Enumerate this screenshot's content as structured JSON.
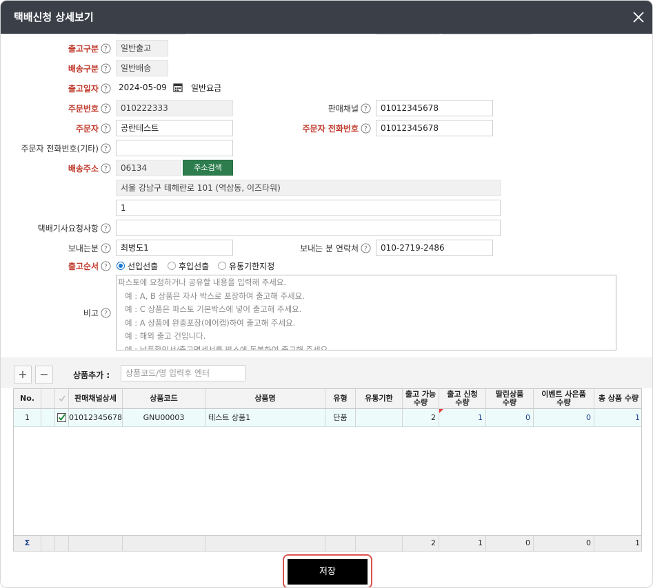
{
  "window": {
    "title": "택배신청 상세보기"
  },
  "form": {
    "out_type": {
      "label": "출고구분",
      "value": "일반출고"
    },
    "ship_type": {
      "label": "배송구분",
      "value": "일반배송"
    },
    "out_date": {
      "label": "출고일자",
      "value": "2024-05-09",
      "fee": "일반요금"
    },
    "order_no": {
      "label": "주문번호",
      "value": "010222333"
    },
    "sales_channel": {
      "label": "판매채널",
      "value": "01012345678"
    },
    "orderer": {
      "label": "주문자",
      "value": "공란테스트"
    },
    "orderer_phone": {
      "label": "주문자 전화번호",
      "value": "01012345678"
    },
    "orderer_phone_etc": {
      "label": "주문자 전화번호(기타)",
      "value": ""
    },
    "address": {
      "label": "배송주소",
      "zip": "06134",
      "search_button": "주소검색",
      "line1": "서울 강남구 테헤란로 101 (역삼동, 이즈타워)",
      "line2": "1"
    },
    "courier_request": {
      "label": "택배기사요청사항",
      "value": ""
    },
    "sender": {
      "label": "보내는분",
      "value": "최병도1"
    },
    "sender_phone": {
      "label": "보내는 분 연락처",
      "value": "010-2719-2486"
    },
    "out_order": {
      "label": "출고순서",
      "options": [
        "선입선출",
        "후입선출",
        "유통기한지정"
      ],
      "selected": "선입선출"
    },
    "memo": {
      "label": "비고",
      "placeholder_lines": [
        "파스토에 요청하거나 공유할 내용을 입력해 주세요.",
        "예 : A, B 상품은 자사 박스로 포장하여 출고해 주세요.",
        "예 : C 상품은 파스토 기본박스에 넣어 출고해 주세요.",
        "예 : A 상품에 완충포장(에어캡)하여 출고해 주세요.",
        "예 : 해외 출고 건입니다.",
        "예 : 납품확인서/출고명세서를 박스에 동봉하여 출고해 주세요."
      ]
    }
  },
  "product_bar": {
    "add_label": "상품추가 :",
    "add_placeholder": "상품코드/명 입력후 엔터",
    "plus": "+",
    "minus": "−"
  },
  "grid": {
    "headers": {
      "no": "No.",
      "channel": "판매채널상세",
      "code": "상품코드",
      "name": "상품명",
      "type": "유형",
      "expiry": "유통기한",
      "avail_1": "출고 가능",
      "avail_2": "수량",
      "req_1": "출고 신청",
      "req_2": "수량",
      "attached_1": "딸린상품",
      "attached_2": "수량",
      "gift_1": "이벤트 사은품",
      "gift_2": "수량",
      "total": "총 상품 수량"
    },
    "rows": [
      {
        "no": "1",
        "channel": "01012345678",
        "code": "GNU00003",
        "name": "테스트 상품1",
        "type": "단품",
        "expiry": "",
        "avail": "2",
        "req": "1",
        "attached": "0",
        "gift": "0",
        "total": "1"
      }
    ],
    "sum": {
      "symbol": "Σ",
      "avail": "2",
      "req": "1",
      "attached": "0",
      "gift": "0",
      "total": "1"
    }
  },
  "save_button": "저장",
  "colors": {
    "title_bar": "#3a3f48",
    "required_label": "#c0392b",
    "search_button": "#2e7d4f",
    "radio_selected": "#1976d2",
    "save_highlight": "#d9534f"
  }
}
